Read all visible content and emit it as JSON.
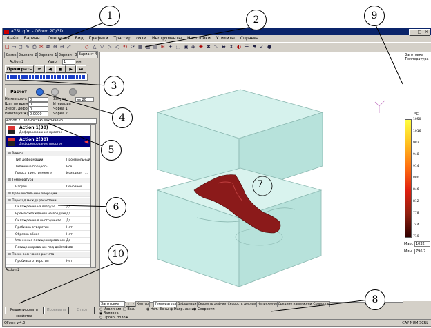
{
  "window": {
    "title": "a7SL.qfm - QForm 2D/3D"
  },
  "menu": [
    "Файл",
    "Вариант",
    "Операция",
    "Вид",
    "Графики",
    "Трассир. точки",
    "Инструменты",
    "Настройки",
    "Утилиты",
    "Справка"
  ],
  "left_panel": {
    "tabs": [
      "Cases",
      "Вариант 2",
      "Вариант 1",
      "Вариант 3",
      "Вариант 4"
    ],
    "action_label": "Action 2",
    "mode_label": "Удар",
    "mode_value": "1",
    "units": "мм",
    "play_label": "Проиграть",
    "run_label": "Расчет",
    "stats": [
      {
        "label": "Номер шага",
        "value": "0",
        "label2": "Запуск",
        "value2": "из 20"
      },
      {
        "label": "Шаг по времени",
        "value": "0",
        "label2": "Итерация",
        "value2": ""
      },
      {
        "label": "Энерг. деформ.",
        "value": "0",
        "label2": "Чорна 1",
        "value2": ""
      },
      {
        "label": "Работа(кДж)",
        "value": "0.0000",
        "label2": "Чорна 2",
        "value2": ""
      }
    ],
    "status_text": "Action 2. Полностью закончено",
    "tree": [
      {
        "title": "Action 1(30)",
        "subtitle": "Деформирование простое",
        "selected": false
      },
      {
        "title": "Action 2(30)",
        "subtitle": "Деформирование простое",
        "selected": true
      }
    ],
    "props": [
      {
        "label": "Задача",
        "value": "",
        "group": true
      },
      {
        "label": "Тип деформации",
        "value": "Произвольный",
        "group": false
      },
      {
        "label": "Типичные процессы",
        "value": "Все",
        "group": false
      },
      {
        "label": "Голоса в инструменте",
        "value": "Исходная т...",
        "group": false
      },
      {
        "label": "Температура",
        "value": "",
        "group": true
      },
      {
        "label": "Нагрев",
        "value": "Основной",
        "group": false
      },
      {
        "label": "Дополнительные операции",
        "value": "",
        "group": true
      },
      {
        "label": "Переход между расчетами",
        "value": "",
        "group": true
      },
      {
        "label": "Охлаждение на воздухе",
        "value": "Да",
        "group": false
      },
      {
        "label": "Время охлаждения на воздухе",
        "value": "Да",
        "group": false
      },
      {
        "label": "Охлаждение в инструменте",
        "value": "Да",
        "group": false
      },
      {
        "label": "Пробивка отверстия",
        "value": "Нет",
        "group": false
      },
      {
        "label": "Обрезка облоя",
        "value": "Нет",
        "group": false
      },
      {
        "label": "Уточнение позиционирования",
        "value": "Да",
        "group": false
      },
      {
        "label": "Позиционирование под действием",
        "value": "Нет",
        "group": false
      },
      {
        "label": "После окончания расчета",
        "value": "",
        "group": true
      },
      {
        "label": "Пробивка отверстия",
        "value": "Нет",
        "group": false
      }
    ],
    "footer_label": "Action 2",
    "edit_button": "Редактировать свойства",
    "btn_b": "Проверить",
    "btn_c": "Старт"
  },
  "right_panel": {
    "title_line1": "Заготовка",
    "title_line2": "Температура",
    "unit": "°C",
    "ticks": [
      "1050",
      "1016",
      "982",
      "948",
      "914",
      "880",
      "846",
      "812",
      "778",
      "744",
      "710"
    ],
    "max_label": "Макс",
    "max_value": "1032",
    "min_label": "Мин",
    "min_value": "796.7"
  },
  "bottom": {
    "dropdown": "Заготовка",
    "tabs": [
      "Контур",
      "Температура",
      "Деформация",
      "Скорость деф-ии",
      "Скорость деф-ии",
      "Напряжения",
      "Средние напряжения",
      "Скорости"
    ],
    "legend": [
      {
        "label": "Вкл.",
        "check": "□"
      },
      {
        "label": "Нет. Зоны",
        "check": "◉"
      },
      {
        "label": "Нагр. линии",
        "check": "◉"
      },
      {
        "label": "Скорости",
        "check": "◉"
      }
    ],
    "options": [
      "Изолиния",
      "Заливка",
      "Прозр. полож."
    ]
  },
  "status": {
    "left": "QForm v.4.3",
    "right": "CAP NUM SCRL"
  },
  "callouts": [
    "1",
    "2",
    "3",
    "4",
    "5",
    "6",
    "7",
    "8",
    "9",
    "10"
  ],
  "colors": {
    "die": "#c7ece6",
    "die_edge": "#8ab7b0",
    "billet": "#8b1a1a",
    "title": "#0a246a",
    "selected": "#000080"
  }
}
